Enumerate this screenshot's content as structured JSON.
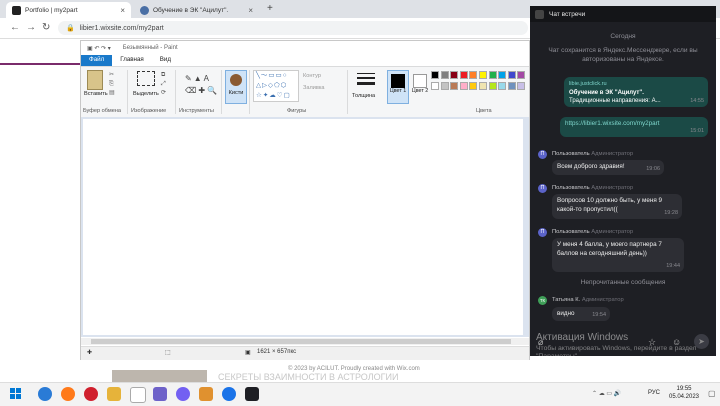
{
  "browser": {
    "tabs": [
      {
        "title": "Portfolio | my2part",
        "active": true
      },
      {
        "title": "Обучение в ЭК \"Ацилут\".",
        "active": false
      }
    ],
    "new_tab": "+",
    "url": "libier1.wixsite.com/my2part",
    "nav": {
      "back": "←",
      "forward": "→",
      "reload": "↻"
    }
  },
  "paint": {
    "title": "Безымянный - Paint",
    "ribbon_tabs": [
      "Файл",
      "Главная",
      "Вид"
    ],
    "groups": {
      "clipboard": {
        "label": "Буфер обмена",
        "paste": "Вставить"
      },
      "image": {
        "label": "Изображение",
        "select": "Выделить"
      },
      "tools": {
        "label": "Инструменты"
      },
      "brushes": {
        "label": "Кисти"
      },
      "shapes": {
        "label": "Фигуры",
        "outline": "Контур",
        "fill": "Заливка"
      },
      "size": {
        "label": "Толщина"
      },
      "color1": "Цвет 1",
      "color2": "Цвет 2",
      "colors": {
        "label": "Цвета"
      }
    },
    "palette": [
      "#000000",
      "#7f7f7f",
      "#880015",
      "#ed1c24",
      "#ff7f27",
      "#fff200",
      "#22b14c",
      "#00a2e8",
      "#3f48cc",
      "#a349a4",
      "#ffffff",
      "#c3c3c3",
      "#b97a57",
      "#ffaec9",
      "#ffc90e",
      "#efe4b0",
      "#b5e61d",
      "#99d9ea",
      "#7092be",
      "#c8bfe7"
    ],
    "status": {
      "dimensions": "1621 × 657пкс"
    }
  },
  "page_bg": {
    "footer": "© 2023 by ACILUT. Proudly created with Wix.com",
    "heading": "СЕКРЕТЫ ВЗАИМНОСТИ В АСТРОЛОГИИ"
  },
  "chat": {
    "title": "Чат встречи",
    "today": "Сегодня",
    "notice": "Чат сохранится в Яндекс.Мессенджере, если вы авторизованы на Яндексе.",
    "link_card": {
      "domain": "libie.justclick.ru",
      "line1": "Обучение в ЭК \"Ацилут\".",
      "line2": "Традиционные направления: А...",
      "time": "14:55"
    },
    "my_link": {
      "text": "https://libier1.wixsite.com/my2part",
      "time": "15:01"
    },
    "messages": [
      {
        "author": "Пользователь",
        "role": "Администратор",
        "avatar": "П",
        "text": "Всем доброго здравия!",
        "time": "19:06"
      },
      {
        "author": "Пользователь",
        "role": "Администратор",
        "avatar": "П",
        "text": "Вопросов 10 должно быть, у меня 9 какой-то пропустил((",
        "time": "19:28"
      },
      {
        "author": "Пользователь",
        "role": "Администратор",
        "avatar": "П",
        "text": "У меня 4 балла, у моего партнера 7 баллов на сегодняшний день))",
        "time": "19:44"
      }
    ],
    "unread": "Непрочитанные сообщения",
    "last": {
      "author": "Татьяна К.",
      "role": "Администратор",
      "avatar": "ТК",
      "text": "видно",
      "time": "19:54"
    },
    "watermark1": "Активация Windows",
    "watermark2": "Чтобы активировать Windows, перейдите в раздел \"Параметры\"."
  },
  "taskbar": {
    "lang": "РУС",
    "time": "19:55",
    "date": "05.04.2023"
  }
}
